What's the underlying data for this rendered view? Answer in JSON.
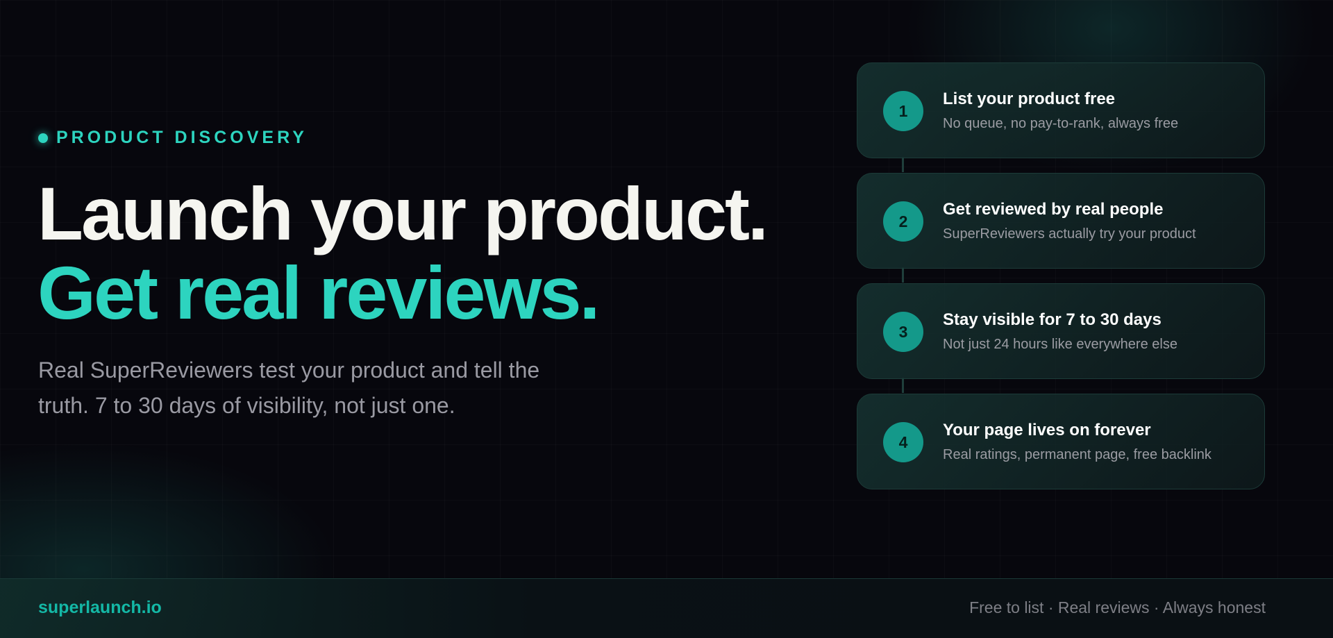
{
  "hero": {
    "eyebrow": "PRODUCT DISCOVERY",
    "headline": "Launch your product.",
    "headline_accent": "Get real reviews.",
    "subtext": "Real SuperReviewers test your product and tell the truth. 7 to 30 days of visibility, not just one."
  },
  "steps": [
    {
      "number": "1",
      "title": "List your product free",
      "description": "No queue, no pay-to-rank, always free"
    },
    {
      "number": "2",
      "title": "Get reviewed by real people",
      "description": "SuperReviewers actually try your product"
    },
    {
      "number": "3",
      "title": "Stay visible for 7 to 30 days",
      "description": "Not just 24 hours like everywhere else"
    },
    {
      "number": "4",
      "title": "Your page lives on forever",
      "description": "Real ratings, permanent page, free backlink"
    }
  ],
  "footer": {
    "brand": "superlaunch.io",
    "tagline": "Free to list · Real reviews · Always honest"
  },
  "colors": {
    "accent": "#2dd4bf",
    "step_badge": "#14998a",
    "background": "#07070d"
  }
}
